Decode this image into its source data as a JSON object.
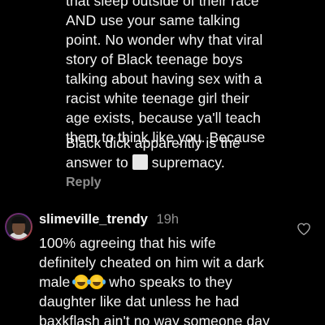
{
  "comment1": {
    "lines": [
      "that sleep outside of their race",
      "AND use your same talking",
      "point. No wonder why that viral",
      "story of Black teenage boys",
      "talking about having sex with a",
      "racist white teenage girl their",
      "age exists, because ya'll teach",
      "them to think like you. Because",
      "Black dick apparently is the"
    ],
    "last_line_before": "answer to",
    "last_line_after": "supremacy.",
    "reply_label": "Reply"
  },
  "comment2": {
    "username": "slimeville_trendy",
    "timestamp": "19h",
    "line1": "100% agreeing that his wife",
    "line2": "definitely cheated on him wit a dark",
    "line3_before": "male",
    "line3_after": "who speaks to they",
    "line4": "daughter like dat unless he had",
    "line5": "baxkflash ain't no way someone day"
  },
  "icons": {
    "heart": "heart-outline-icon",
    "emoji": "face-with-tears-of-joy-emoji",
    "square": "white-large-square-emoji"
  },
  "colors": {
    "background": "#000000",
    "text": "#f5f5f5",
    "muted": "#8e8e8e"
  }
}
